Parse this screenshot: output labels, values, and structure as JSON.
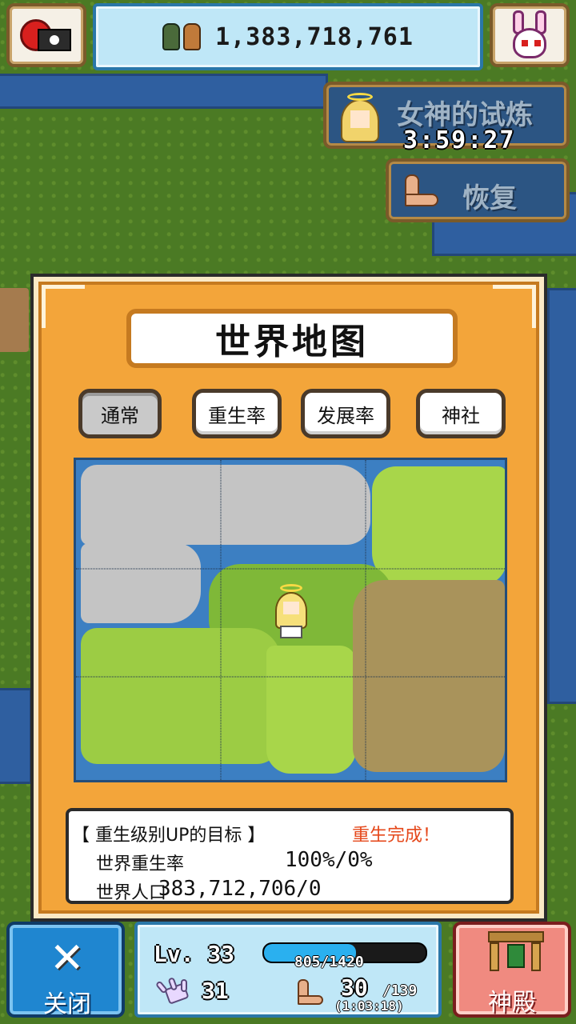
{
  "header": {
    "currency_value": "1,383,718,761"
  },
  "events": {
    "trial_label": "女神的试炼",
    "trial_timer": "3:59:27",
    "recover_label": "恢复"
  },
  "panel": {
    "title": "世界地图",
    "tabs": [
      {
        "label": "通常",
        "active": true
      },
      {
        "label": "重生率",
        "active": false
      },
      {
        "label": "发展率",
        "active": false
      },
      {
        "label": "神社",
        "active": false
      }
    ]
  },
  "info": {
    "header": "【 重生级别UP的目标 】",
    "status": "重生完成！",
    "rows": [
      {
        "label": "世界重生率",
        "value": "100%/0%"
      },
      {
        "label": "世界人口",
        "value": "383,712,706/0"
      }
    ]
  },
  "bottom": {
    "close_label": "关闭",
    "temple_label": "神殿",
    "level_label": "Lv. 33",
    "xp_text": "805/1420",
    "xp_fraction": 0.567,
    "power_value": "31",
    "stamina_value": "30",
    "stamina_max": "/139",
    "stamina_timer": "(1:03:18)"
  },
  "colors": {
    "panel_orange": "#f3a53a",
    "accent_blue": "#2a77a8",
    "status_red": "#e5481b"
  },
  "icons": [
    "camera-icon",
    "bunny-icon",
    "party-icon",
    "goddess-icon",
    "arm-icon",
    "close-x-icon",
    "temple-icon",
    "hand-icon",
    "stamina-icon"
  ]
}
